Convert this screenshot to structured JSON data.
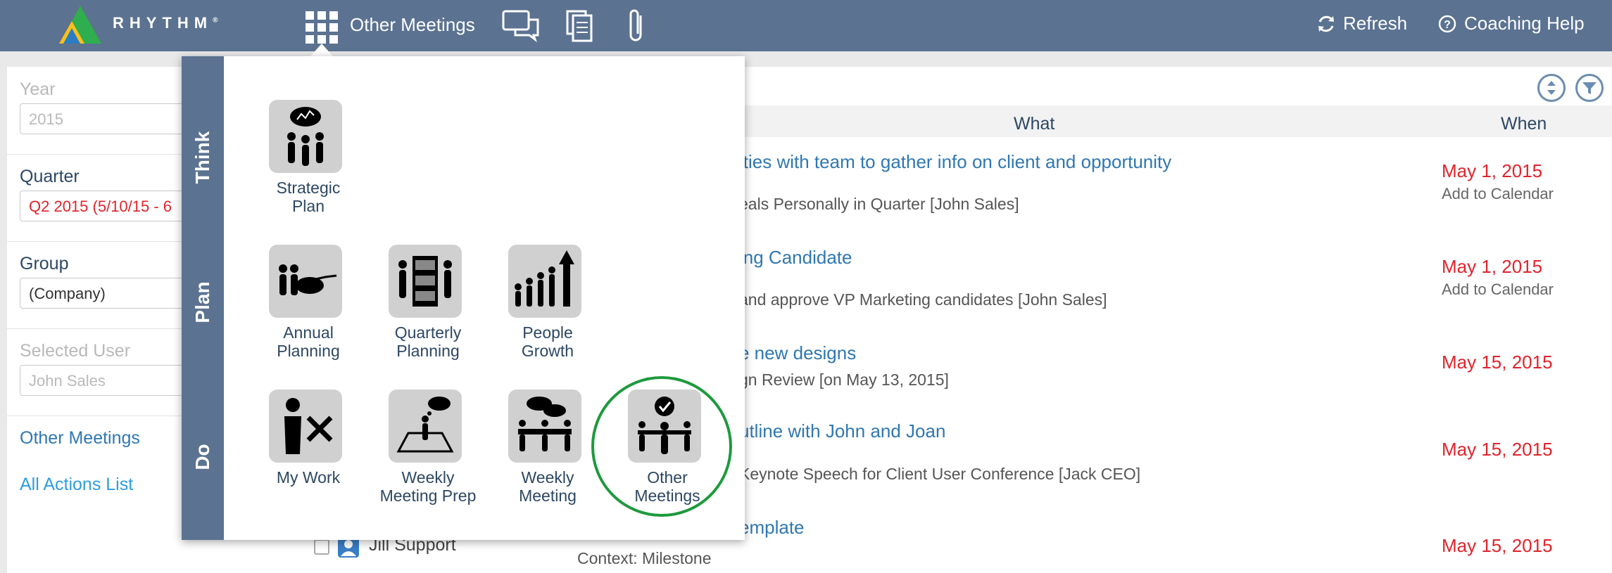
{
  "brand": {
    "name": "RHYTHM",
    "reg": "®"
  },
  "topbar": {
    "menu_title": "Other Meetings",
    "refresh": "Refresh",
    "help": "Coaching Help",
    "icons": [
      "apps-grid-icon",
      "chat-icon",
      "documents-icon",
      "paperclip-icon",
      "refresh-icon",
      "help-circle-icon"
    ]
  },
  "filters": {
    "year": {
      "label": "Year",
      "value": "2015"
    },
    "quarter": {
      "label": "Quarter",
      "value": "Q2 2015 (5/10/15 - 6"
    },
    "group": {
      "label": "Group",
      "value": "(Company)"
    },
    "user": {
      "label": "Selected User",
      "value": "John Sales"
    },
    "links": [
      "Other Meetings",
      "All Actions List"
    ]
  },
  "table": {
    "headers": {
      "what": "What",
      "when": "When"
    },
    "rows": [
      {
        "title": "ities with team to gather info on client and opportunity",
        "sub": "eals Personally in Quarter [John Sales]",
        "date": "May 1, 2015",
        "cal": "Add to Calendar"
      },
      {
        "title": "ing Candidate",
        "sub": "and approve VP Marketing candidates [John Sales]",
        "date": "May 1, 2015",
        "cal": "Add to Calendar"
      },
      {
        "title": "e new designs",
        "sub": "gn Review [on May 13, 2015]",
        "date": "May 15, 2015",
        "cal": ""
      },
      {
        "title": "utline with John and Joan",
        "sub": "Keynote Speech for Client User Conference [Jack CEO]",
        "date": "May 15, 2015",
        "cal": ""
      },
      {
        "title": "emplate",
        "sub": "Context: Milestone",
        "date": "May 15, 2015",
        "cal": "",
        "owner": "Jill Support"
      }
    ]
  },
  "dropdown": {
    "sections": [
      "Think",
      "Plan",
      "Do"
    ],
    "tiles": [
      {
        "label_1": "Strategic",
        "label_2": "Plan"
      },
      {
        "label_1": "Annual",
        "label_2": "Planning"
      },
      {
        "label_1": "Quarterly",
        "label_2": "Planning"
      },
      {
        "label_1": "People",
        "label_2": "Growth"
      },
      {
        "label_1": "My Work",
        "label_2": ""
      },
      {
        "label_1": "Weekly",
        "label_2": "Meeting Prep"
      },
      {
        "label_1": "Weekly",
        "label_2": "Meeting"
      },
      {
        "label_1": "Other",
        "label_2": "Meetings"
      }
    ]
  },
  "colors": {
    "header_bg": "#5b7291",
    "link": "#2f77b1",
    "date_red": "#e0242c",
    "highlight_ring": "#1e9a3e"
  }
}
